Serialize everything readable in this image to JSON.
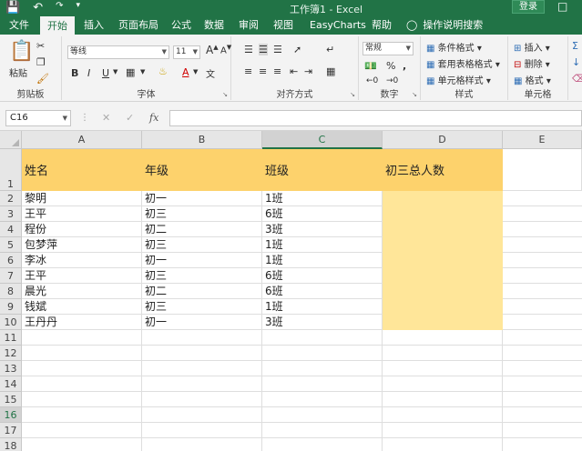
{
  "title_bar": {
    "save_icon": "save-icon",
    "undo_icon": "undo-icon",
    "title": "工作簿1 - Excel",
    "login": "登录",
    "window_icon": "ribbon-display-icon"
  },
  "tabs": [
    "文件",
    "开始",
    "插入",
    "页面布局",
    "公式",
    "数据",
    "审阅",
    "视图",
    "EasyCharts",
    "帮助"
  ],
  "tell_me": "操作说明搜索",
  "ribbon": {
    "clipboard": {
      "paste": "粘贴",
      "label": "剪贴板"
    },
    "font": {
      "name": "等线",
      "size": "11",
      "bold": "B",
      "italic": "I",
      "underline": "U",
      "grow": "A",
      "shrink": "A",
      "color_letter": "A",
      "label": "字体"
    },
    "alignment": {
      "label": "对齐方式"
    },
    "number": {
      "format": "常规",
      "percent": "%",
      "comma": ",",
      "label": "数字"
    },
    "styles": {
      "conditional": "条件格式",
      "table": "套用表格格式",
      "cell_styles": "单元格样式",
      "label": "样式"
    },
    "cells": {
      "insert": "插入",
      "delete": "删除",
      "format": "格式",
      "label": "单元格"
    }
  },
  "formula_bar": {
    "name_box": "C16",
    "cancel": "✕",
    "enter": "✓",
    "fx": "fx",
    "value": ""
  },
  "columns": [
    "A",
    "B",
    "C",
    "D",
    "E"
  ],
  "rows": [
    "1",
    "2",
    "3",
    "4",
    "5",
    "6",
    "7",
    "8",
    "9",
    "10",
    "11",
    "12",
    "13",
    "14",
    "15",
    "16",
    "17",
    "18"
  ],
  "header_row": [
    "姓名",
    "年级",
    "班级",
    "初三总人数"
  ],
  "data_rows": [
    [
      "黎明",
      "初一",
      "1班"
    ],
    [
      "王平",
      "初三",
      "6班"
    ],
    [
      "程份",
      "初二",
      "3班"
    ],
    [
      "包梦萍",
      "初三",
      "1班"
    ],
    [
      "李冰",
      "初一",
      "1班"
    ],
    [
      "王平",
      "初三",
      "6班"
    ],
    [
      "晨光",
      "初二",
      "6班"
    ],
    [
      "钱斌",
      "初三",
      "1班"
    ],
    [
      "王丹丹",
      "初一",
      "3班"
    ]
  ],
  "colors": {
    "excel_green": "#217346",
    "header_fill": "#fdd26c",
    "d_column_fill": "#ffe699"
  }
}
